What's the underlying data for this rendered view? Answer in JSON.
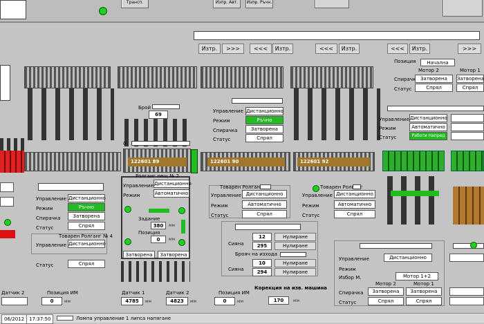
{
  "top_buttons": [
    "Трансп.",
    "Изпр. Авт.",
    "Изпр. Ръчн.",
    "",
    "",
    ""
  ],
  "nav_buttons": [
    "Изтр.",
    ">>>",
    "<<<",
    "Изтр.",
    "<<<",
    "Изтр.",
    "<<<",
    "Изтр.",
    ">>>",
    "<<<",
    "Изтр.",
    ">>>"
  ],
  "brojach": {
    "label": "Брой",
    "value": "69"
  },
  "zero_label": "0",
  "tags": [
    "122601  89",
    "122601  90",
    "122601  92"
  ],
  "panel_center": {
    "rows": [
      "Управление",
      "Режим",
      "Спирачка",
      "Статус"
    ],
    "values": [
      "Дистанционно",
      "Ръчно",
      "Затворена",
      "Спрял"
    ]
  },
  "panel_right_top": {
    "title_label": "Позиция",
    "title_value": "Начална",
    "motor2": "Мотор 2",
    "motor1": "Мотор 1",
    "rows": [
      "Спирачка",
      "Статус"
    ],
    "m2_values": [
      "Затворена",
      "Спрял"
    ],
    "m1_values": [
      "Затворена",
      "Спрял"
    ]
  },
  "panel_right_mid": {
    "rows": [
      "Управление",
      "Режим",
      "Статус"
    ],
    "values": [
      "Дистанционно",
      "Автоматично",
      "Работи Напред"
    ]
  },
  "panel_left": {
    "rows": [
      "Управление",
      "Режим",
      "Спирачка",
      "Статус"
    ],
    "values": [
      "Дистанционно",
      "Ръчно",
      "Затворена",
      "Спрял"
    ]
  },
  "panel_left_lower": {
    "title": "Товарен Ролганг № 4",
    "rows": [
      "Управление",
      "Статус"
    ],
    "values": [
      "Дистанционно",
      "Спрял"
    ]
  },
  "panel_rolgang2": {
    "title": "Ролганг пещ № 2",
    "rows": [
      "Управление",
      "Режим"
    ],
    "values": [
      "Дистанционно",
      "Автоматично"
    ],
    "zad_label": "Задание",
    "zad_value": "380",
    "zad_unit": "мм",
    "poz_label": "Позиция",
    "poz_value": "0",
    "poz_unit": "мм",
    "bottom": [
      "Затворена",
      "Затворена"
    ]
  },
  "panel_tovaren": {
    "title": "Товарен Ролганг",
    "rows": [
      "Управление",
      "Режим",
      "Статус"
    ],
    "values": [
      "Дистанционно",
      "Автоматично",
      "Спрял"
    ]
  },
  "panel_tovaren2": {
    "title": "Товарен Ролганг",
    "rows": [
      "Управление",
      "Режим",
      "Статус"
    ],
    "values": [
      "Дистанционно",
      "Автоматично",
      "Спрял"
    ]
  },
  "panel_siyana": {
    "label1": "Сияна",
    "v1": "12",
    "v2": "295",
    "btn": "Нулиране",
    "brojach_label": "Брояч на изхода",
    "v3": "10",
    "v4": "294",
    "label2": "Сияна"
  },
  "korekcia": {
    "label": "Корекция на изв. машина",
    "value": "170",
    "unit": "мм"
  },
  "panel_bottom_right": {
    "rows": [
      "Управление",
      "Режим",
      "Избор М.",
      "Спирачка",
      "Статус"
    ],
    "values": [
      "Дистанционно",
      "Мотор 1+2"
    ],
    "motor2": "Мотор 2",
    "motor1": "Мотор 1",
    "m2_values": [
      "Затворена",
      "Спрял"
    ],
    "m1_values": [
      "Затворена",
      "Спрял"
    ]
  },
  "sensors": [
    {
      "label": "Датчик 2",
      "value": ""
    },
    {
      "label": "Позиция ИМ",
      "value": "0",
      "unit": "мм"
    },
    {
      "label": "Датчик 1",
      "value": "4785",
      "unit": "мм"
    },
    {
      "label": "Датчик 2",
      "value": "4823",
      "unit": "мм"
    },
    {
      "label": "Позиция ИМ",
      "value": "0",
      "unit": "мм"
    }
  ],
  "status_bar": {
    "date": "06/2012",
    "time": "17:37:50",
    "message": "Ломпа  управление 1 липса напягане"
  }
}
